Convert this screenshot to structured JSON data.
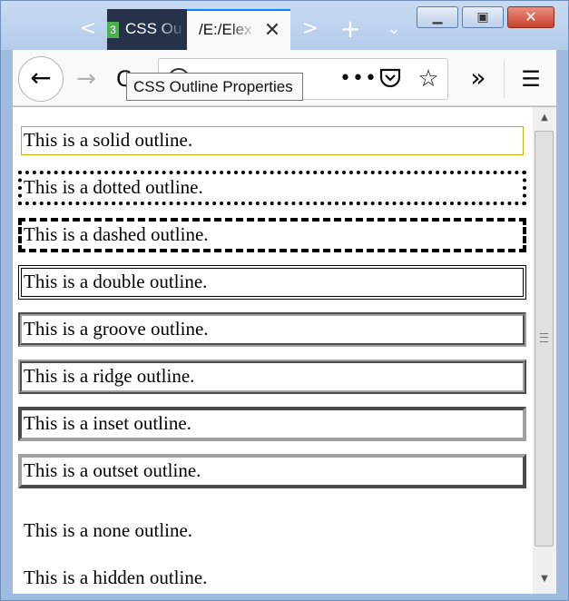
{
  "window": {
    "minimize_icon": "minimize-icon",
    "maximize_icon": "maximize-icon",
    "close_icon": "close-icon",
    "close_color": "#c7402b"
  },
  "tabs": [
    {
      "label": "CSS Ou",
      "favicon_text": "3",
      "active": false
    },
    {
      "label": "/E:/Elex",
      "active": true
    }
  ],
  "tab_accent": "#0a84ff",
  "toolbar": {
    "back_icon": "←",
    "forward_icon": "→",
    "reload_icon": "C",
    "page_actions": "•••",
    "star_icon": "☆",
    "overflow_icon": "»",
    "menu_icon": "☰",
    "tab_scroll_left": "<",
    "tab_scroll_right": ">",
    "new_tab": "+",
    "tab_list": "⌄"
  },
  "tooltip": {
    "text": "CSS Outline Properties"
  },
  "page": {
    "lines": [
      {
        "style": "solid",
        "text": "This is a solid outline."
      },
      {
        "style": "dotted",
        "text": "This is a dotted outline."
      },
      {
        "style": "dashed",
        "text": "This is a dashed outline."
      },
      {
        "style": "double",
        "text": "This is a double outline."
      },
      {
        "style": "groove",
        "text": "This is a groove outline."
      },
      {
        "style": "ridge",
        "text": "This is a ridge outline."
      },
      {
        "style": "inset",
        "text": "This is a inset outline."
      },
      {
        "style": "outset",
        "text": "This is a outset outline."
      },
      {
        "style": "none",
        "text": "This is a none outline."
      },
      {
        "style": "hidden",
        "text": "This is a hidden outline."
      }
    ],
    "solid_outline_color": "#c5b300"
  },
  "scrollbar": {
    "up_icon": "▲",
    "down_icon": "▼"
  }
}
